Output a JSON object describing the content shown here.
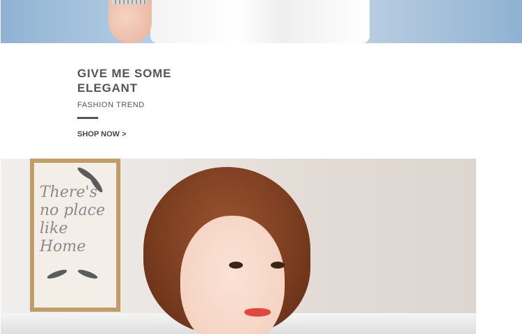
{
  "banner": {
    "headline_line1": "GIVE ME SOME",
    "headline_line2": "ELEGANT",
    "subline": "FASHION TREND",
    "cta_label": "SHOP NOW >"
  },
  "frame_art": {
    "text": "There's\nno place\nlike\nHome"
  },
  "colors": {
    "text_primary": "#555555",
    "divider": "#555555",
    "background": "#ffffff"
  }
}
